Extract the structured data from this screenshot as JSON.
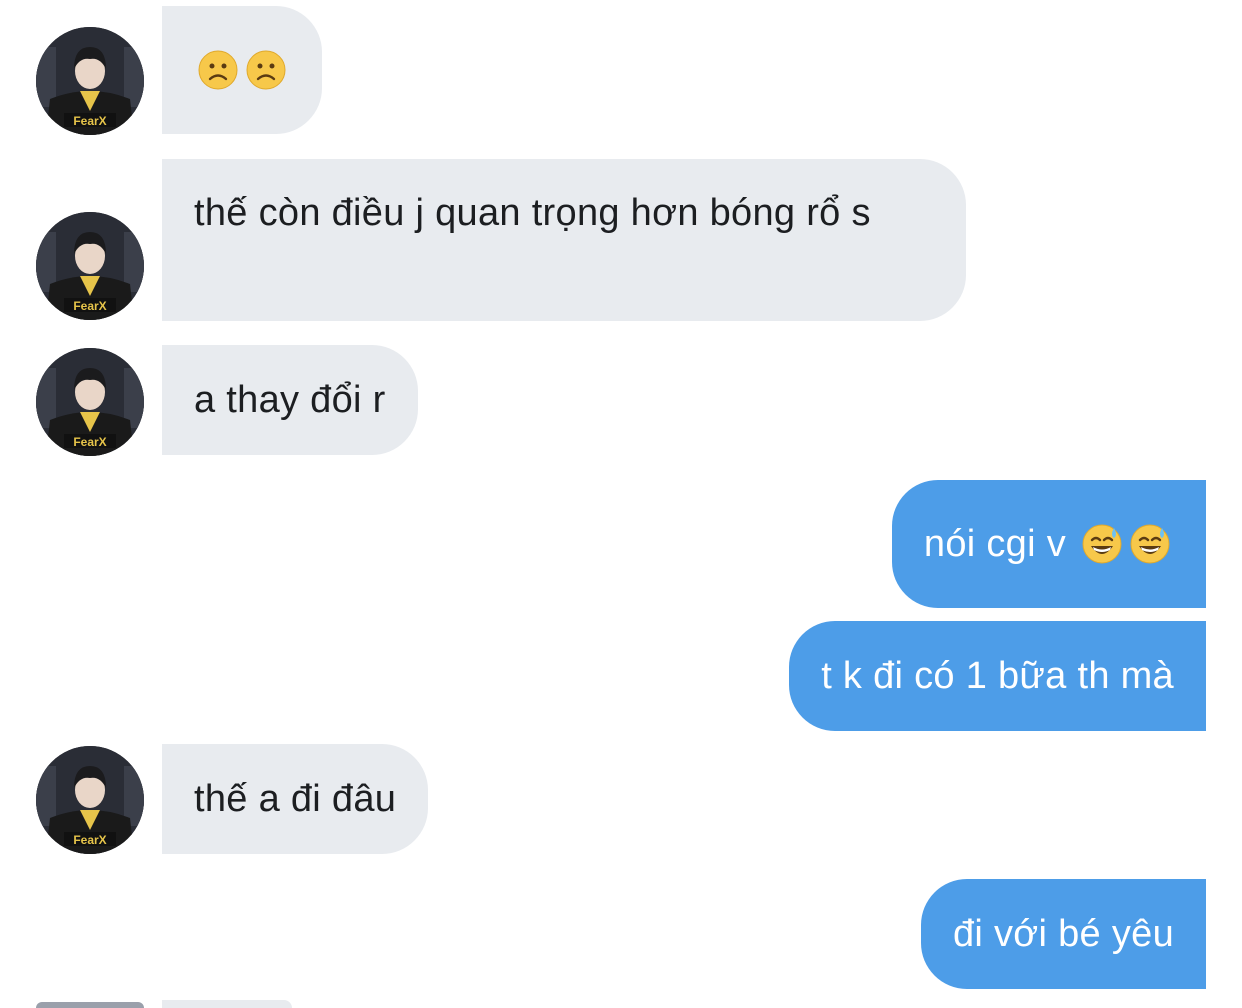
{
  "conversation": {
    "messages": [
      {
        "direction": "incoming",
        "emojis": [
          "slightly-frowning-face",
          "slightly-frowning-face"
        ],
        "text": ""
      },
      {
        "direction": "incoming",
        "text": "thế còn điều j quan trọng hơn bóng rổ s"
      },
      {
        "direction": "incoming",
        "text": "a thay đổi r"
      },
      {
        "direction": "outgoing",
        "text": "nói cgi v",
        "emojis": [
          "grinning-face-with-sweat",
          "grinning-face-with-sweat"
        ]
      },
      {
        "direction": "outgoing",
        "text": "t k đi có 1 bữa th mà"
      },
      {
        "direction": "incoming",
        "text": "thế a đi đâu"
      },
      {
        "direction": "outgoing",
        "text": "đi với bé yêu"
      }
    ]
  },
  "avatar": {
    "jersey_text": "FearX",
    "colors": {
      "jersey": "#1a1a1a",
      "accent": "#e6c44a",
      "skin": "#e9d6c8",
      "hair": "#1b1b1d"
    }
  },
  "colors": {
    "incoming_bubble": "#e8ebef",
    "outgoing_bubble": "#4d9de8",
    "incoming_text": "#1c1e21",
    "outgoing_text": "#ffffff",
    "background": "#ffffff"
  }
}
